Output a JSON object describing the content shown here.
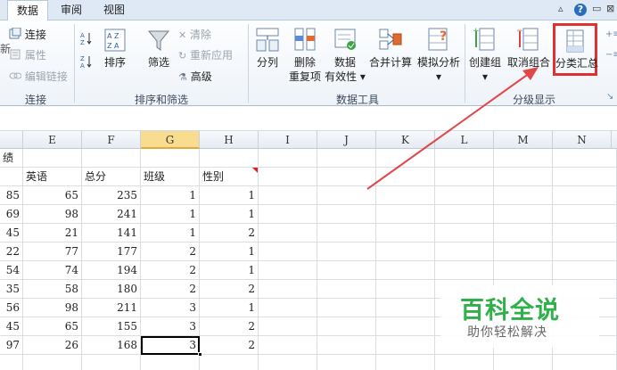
{
  "tabs": {
    "data": "数据",
    "review": "审阅",
    "view": "视图"
  },
  "window_controls": {
    "help": "?",
    "minimize": "▭",
    "close": "⊠"
  },
  "ribbon": {
    "connections": {
      "connect": "连接",
      "properties": "属性",
      "edit_links": "编辑链接",
      "label": "连接",
      "cut_text": "新"
    },
    "sort_filter": {
      "sort_az": "A↓",
      "sort_za": "Z↓",
      "sort": "排序",
      "filter": "筛选",
      "clear": "清除",
      "reapply": "重新应用",
      "advanced": "高级",
      "label": "排序和筛选"
    },
    "data_tools": {
      "text_to_columns": "分列",
      "remove_dup_1": "删除",
      "remove_dup_2": "重复项",
      "validation_1": "数据",
      "validation_2": "有效性 ▾",
      "consolidate": "合并计算",
      "what_if": "模拟分析",
      "what_if_arrow": "▾",
      "label": "数据工具"
    },
    "outline": {
      "group": "创建组",
      "group_arrow": "▾",
      "ungroup": "取消组合",
      "subtotal": "分类汇总",
      "label": "分级显示"
    }
  },
  "sheet": {
    "columns": [
      "E",
      "F",
      "G",
      "H",
      "I",
      "J",
      "K",
      "L",
      "M",
      "N"
    ],
    "selected_column": "G",
    "partial_title": "绩",
    "headers": {
      "english": "英语",
      "total": "总分",
      "class": "班级",
      "gender": "性别"
    },
    "rows": [
      {
        "d": "85",
        "e": "65",
        "f": "235",
        "g": "1",
        "h": "1"
      },
      {
        "d": "69",
        "e": "98",
        "f": "241",
        "g": "1",
        "h": "1"
      },
      {
        "d": "45",
        "e": "21",
        "f": "141",
        "g": "1",
        "h": "2"
      },
      {
        "d": "22",
        "e": "77",
        "f": "177",
        "g": "2",
        "h": "1"
      },
      {
        "d": "54",
        "e": "74",
        "f": "194",
        "g": "2",
        "h": "1"
      },
      {
        "d": "35",
        "e": "58",
        "f": "180",
        "g": "2",
        "h": "2"
      },
      {
        "d": "56",
        "e": "98",
        "f": "211",
        "g": "3",
        "h": "1"
      },
      {
        "d": "45",
        "e": "65",
        "f": "155",
        "g": "3",
        "h": "2"
      },
      {
        "d": "97",
        "e": "26",
        "f": "168",
        "g": "3",
        "h": "2"
      }
    ]
  },
  "watermark": {
    "title": "百科全说",
    "subtitle": "助你轻松解决"
  },
  "colors": {
    "highlight_box": "#e03030",
    "arrow": "#e04848",
    "watermark_green": "#2fb04a"
  }
}
